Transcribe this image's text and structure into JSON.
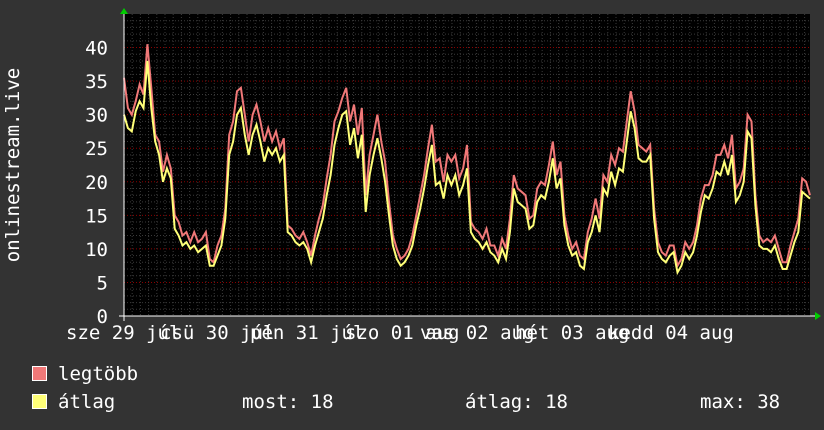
{
  "colors": {
    "background": "#333333",
    "plot_background": "#000000",
    "grid_major": "#8b0000",
    "grid_minor": "#3a3a3a",
    "axis": "#ffffff",
    "arrow": "#00cc00",
    "max_series": "#f07878",
    "avg_series": "#ffff78"
  },
  "legend": {
    "max_label": "legtöbb",
    "avg_label": "átlag",
    "now": "most: 18",
    "average": "átlag: 18",
    "maximum": "max: 38"
  },
  "chart_data": {
    "type": "line",
    "title": "",
    "ylabel": "onlinestream.live",
    "xlabel": "",
    "ylim": [
      0,
      45
    ],
    "y_ticks": [
      0,
      5,
      10,
      15,
      20,
      25,
      30,
      35,
      40
    ],
    "grid": true,
    "legend_position": "bottom-left",
    "x_tick_labels": [
      "sze 29 júl",
      "csü 30 júl",
      "pén 31 júl",
      "szo 01 aug",
      "vas 02 aug",
      "hét 03 aug",
      "kedd 04 aug"
    ],
    "series": [
      {
        "name": "legtöbb",
        "color": "#f07878",
        "values": [
          35.5,
          31.0,
          30.0,
          32.0,
          34.5,
          33.0,
          40.5,
          34.0,
          27.0,
          26.0,
          21.5,
          24.0,
          22.0,
          15.0,
          14.0,
          12.0,
          12.5,
          11.0,
          12.5,
          11.0,
          11.5,
          12.5,
          8.5,
          8.0,
          10.5,
          12.0,
          16.0,
          27.0,
          29.0,
          33.5,
          34.0,
          30.0,
          26.0,
          30.0,
          31.5,
          29.0,
          26.0,
          28.0,
          26.0,
          27.5,
          25.0,
          26.5,
          13.5,
          13.0,
          12.0,
          11.5,
          12.5,
          11.0,
          9.0,
          12.0,
          14.5,
          16.5,
          20.5,
          24.0,
          29.0,
          30.5,
          32.5,
          34.0,
          29.0,
          31.5,
          27.0,
          31.0,
          18.0,
          24.0,
          27.0,
          30.0,
          26.0,
          23.0,
          17.0,
          12.0,
          10.0,
          8.5,
          9.0,
          10.0,
          12.0,
          15.0,
          18.0,
          21.0,
          25.0,
          28.5,
          23.0,
          23.5,
          20.0,
          24.0,
          23.0,
          24.0,
          20.5,
          22.0,
          25.5,
          14.0,
          13.0,
          12.5,
          11.5,
          13.0,
          10.5,
          10.5,
          9.0,
          11.5,
          10.0,
          14.5,
          21.0,
          19.0,
          18.5,
          18.0,
          14.5,
          15.0,
          19.0,
          20.0,
          19.5,
          22.5,
          26.0,
          21.0,
          23.0,
          15.0,
          12.0,
          10.0,
          11.0,
          9.0,
          8.5,
          12.5,
          14.5,
          17.5,
          14.5,
          21.0,
          20.0,
          24.0,
          22.5,
          25.0,
          24.5,
          29.0,
          33.5,
          30.5,
          25.5,
          25.0,
          24.5,
          25.5,
          16.0,
          11.0,
          9.5,
          9.0,
          10.5,
          10.5,
          7.5,
          8.5,
          11.0,
          10.0,
          11.0,
          13.5,
          17.5,
          19.5,
          19.5,
          21.0,
          24.0,
          24.0,
          25.5,
          23.5,
          27.0,
          19.0,
          20.0,
          22.0,
          30.0,
          29.0,
          18.0,
          12.0,
          11.0,
          11.5,
          11.0,
          12.0,
          10.0,
          8.0,
          8.0,
          10.5,
          12.5,
          14.5,
          20.5,
          20.0,
          18.0
        ]
      },
      {
        "name": "átlag",
        "color": "#ffff78",
        "values": [
          30.0,
          28.0,
          27.5,
          30.5,
          32.0,
          31.0,
          38.0,
          31.0,
          26.0,
          24.0,
          20.0,
          22.0,
          20.5,
          13.0,
          12.0,
          10.5,
          11.0,
          10.0,
          10.5,
          9.5,
          10.0,
          10.5,
          7.5,
          7.5,
          9.0,
          10.5,
          14.5,
          24.0,
          26.0,
          30.0,
          31.0,
          27.0,
          24.0,
          27.0,
          28.5,
          26.0,
          23.0,
          25.0,
          24.0,
          25.0,
          23.0,
          24.0,
          12.5,
          12.0,
          11.0,
          10.5,
          11.0,
          10.0,
          8.0,
          10.5,
          12.5,
          14.5,
          18.0,
          21.0,
          25.5,
          28.0,
          30.0,
          30.5,
          25.5,
          28.0,
          23.5,
          27.0,
          15.5,
          21.0,
          24.0,
          26.5,
          23.5,
          20.0,
          15.0,
          10.5,
          8.5,
          7.5,
          8.0,
          9.0,
          10.5,
          13.5,
          16.0,
          19.0,
          22.5,
          25.5,
          19.5,
          20.0,
          17.5,
          21.0,
          19.5,
          21.0,
          18.0,
          19.5,
          22.0,
          12.5,
          11.5,
          11.0,
          10.0,
          11.0,
          9.5,
          9.0,
          8.0,
          10.0,
          8.5,
          12.5,
          19.0,
          17.0,
          16.5,
          16.0,
          13.0,
          13.5,
          17.0,
          18.0,
          17.5,
          20.0,
          23.5,
          19.0,
          20.5,
          13.5,
          10.5,
          9.0,
          9.5,
          7.5,
          7.0,
          11.0,
          12.5,
          15.0,
          12.5,
          19.0,
          18.0,
          21.5,
          19.5,
          22.0,
          21.5,
          26.0,
          30.5,
          28.0,
          23.5,
          23.0,
          23.0,
          24.0,
          14.5,
          9.5,
          8.5,
          8.0,
          9.0,
          9.5,
          6.5,
          7.5,
          9.5,
          8.5,
          9.5,
          12.0,
          15.5,
          18.0,
          17.5,
          19.0,
          21.5,
          21.0,
          23.0,
          21.0,
          24.0,
          17.0,
          18.0,
          20.0,
          27.5,
          26.5,
          16.5,
          10.5,
          10.0,
          10.0,
          9.5,
          10.5,
          8.5,
          7.0,
          7.0,
          9.0,
          11.0,
          12.5,
          18.5,
          18.0,
          17.5
        ]
      }
    ]
  }
}
